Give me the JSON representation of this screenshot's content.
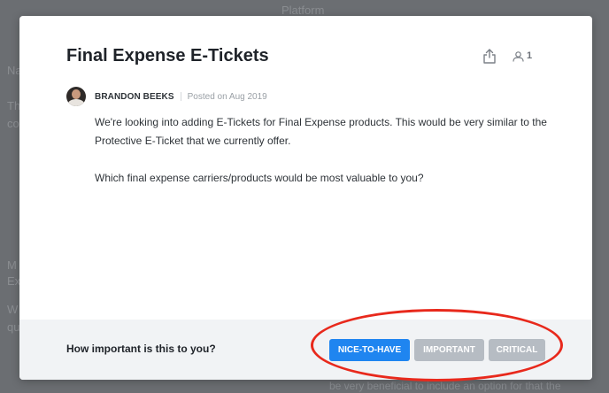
{
  "background": {
    "top_text": "Platform",
    "left_fragments": [
      "Na",
      "Th",
      "co",
      "M",
      "Ex",
      "W",
      "qu"
    ],
    "bottom_text": "be very beneficial to include an option for that the"
  },
  "modal": {
    "title": "Final Expense E-Tickets",
    "voter_count": "1",
    "author": {
      "name": "BRANDON BEEKS",
      "posted": "Posted on Aug 2019"
    },
    "body": [
      "We're looking into adding E-Tickets for Final Expense products. This would be very similar to the Protective E-Ticket that we currently offer.",
      "Which final expense carriers/products would be most valuable to you?"
    ],
    "footer": {
      "question": "How important is this to you?",
      "buttons": {
        "nice": "NICE-TO-HAVE",
        "important": "IMPORTANT",
        "critical": "CRITICAL"
      }
    }
  },
  "colors": {
    "primary": "#1f85f0",
    "inactive": "#b6bcc3",
    "annotation": "#e8291c"
  },
  "icons": {
    "share": "share-icon",
    "voter": "person-icon"
  }
}
